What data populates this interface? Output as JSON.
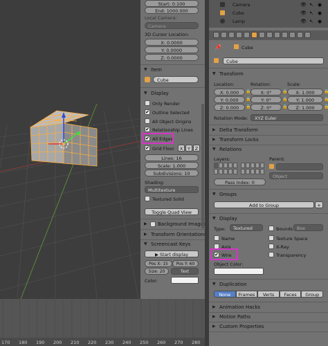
{
  "npanel": {
    "start": "Start: 0.100",
    "end": "End: 1000.000",
    "local_camera_label": "Local Camera:",
    "camera_field": "Camera",
    "cursor_location_label": "3D Cursor Location:",
    "cursor_x": "X: 0.0000",
    "cursor_y": "Y: 0.0000",
    "cursor_z": "Z: 0.0000",
    "item_header": "Item",
    "item_name": "Cube",
    "display_header": "Display",
    "only_render": "Only Render",
    "outline_selected": "Outline Selected",
    "all_object_origins": "All Object Origins",
    "relationship_lines": "Relationship Lines",
    "all_edges": "All Edges",
    "grid_floor": "Grid Floor",
    "axis_x": "X",
    "axis_y": "Y",
    "axis_z": "Z",
    "lines": "Lines: 16",
    "scale": "Scale: 1.000",
    "subdivisions": "Subdivisions: 10",
    "shading_label": "Shading:",
    "shading_value": "Multitexture",
    "textured_solid": "Textured Solid",
    "toggle_quad_view": "Toggle Quad View",
    "background_images": "Background Images",
    "transform_orientations": "Transform Orientations",
    "screencast_keys": "Screencast Keys",
    "start_display": "Start display",
    "pos_x": "Pos X: 15",
    "pos_y": "Pos Y: 60",
    "size": "Size: 20",
    "text_mode": "Text",
    "color_label": "Color:"
  },
  "outliner": {
    "items": [
      "Camera",
      "Cube",
      "Lamp"
    ]
  },
  "props": {
    "object_name_breadcrumb": "Cube",
    "object_name": "Cube",
    "transform_header": "Transform",
    "location_label": "Location:",
    "rotation_label": "Rotation:",
    "scale_label": "Scale:",
    "loc": [
      "X: 0.000",
      "Y: 0.000",
      "Z: 0.000"
    ],
    "rot": [
      "X: 0°",
      "Y: 0°",
      "Z: 0°"
    ],
    "scl": [
      "X: 1.000",
      "Y: 1.000",
      "Z: 1.000"
    ],
    "rotation_mode_label": "Rotation Mode:",
    "rotation_mode_value": "XYZ Euler",
    "delta_transform": "Delta Transform",
    "transform_locks": "Transform Locks",
    "relations": "Relations",
    "layers_label": "Layers:",
    "parent_label": "Parent:",
    "parent_field": "Object",
    "pass_index": "Pass Index: 0",
    "groups": "Groups",
    "add_to_group": "Add to Group",
    "display": "Display",
    "type_label": "Type:",
    "type_value": "Textured",
    "bounds": "Bounds",
    "bounds_type": "Box",
    "name": "Name",
    "texture_space": "Texture Space",
    "axis": "Axis",
    "xray": "X-Ray",
    "wire": "Wire",
    "transparency": "Transparency",
    "object_color": "Object Color:",
    "duplication": "Duplication",
    "dup_options": [
      "None",
      "Frames",
      "Verts",
      "Faces",
      "Group"
    ],
    "animation_hacks": "Animation Hacks",
    "motion_paths": "Motion Paths",
    "custom_properties": "Custom Properties"
  },
  "timeline": {
    "ticks": [
      "170",
      "180",
      "190",
      "200",
      "210",
      "220",
      "230",
      "240",
      "250",
      "260",
      "270",
      "280"
    ]
  }
}
